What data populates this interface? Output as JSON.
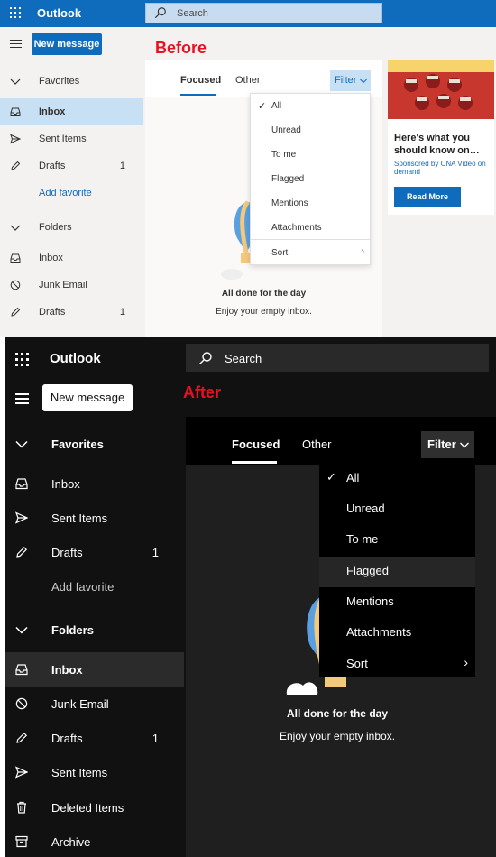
{
  "before": {
    "label": "Before",
    "app_title": "Outlook",
    "search_placeholder": "Search",
    "new_message": "New message",
    "nav": {
      "favorites_header": "Favorites",
      "favorites": [
        {
          "label": "Inbox",
          "count": "",
          "icon": "inbox-icon"
        },
        {
          "label": "Sent Items",
          "count": "",
          "icon": "send-icon"
        },
        {
          "label": "Drafts",
          "count": "1",
          "icon": "pencil-icon"
        }
      ],
      "add_favorite": "Add favorite",
      "folders_header": "Folders",
      "folders": [
        {
          "label": "Inbox",
          "count": "",
          "icon": "inbox-icon"
        },
        {
          "label": "Junk Email",
          "count": "",
          "icon": "block-icon"
        },
        {
          "label": "Drafts",
          "count": "1",
          "icon": "pencil-icon"
        }
      ]
    },
    "tabs": [
      "Focused",
      "Other"
    ],
    "filter_label": "Filter",
    "filter_menu": [
      "All",
      "Unread",
      "To me",
      "Flagged",
      "Mentions",
      "Attachments"
    ],
    "sort_label": "Sort",
    "empty_title": "All done for the day",
    "empty_subtitle": "Enjoy your empty inbox.",
    "ad": {
      "title": "Here's what you should know on…",
      "sponsor": "Sponsored by CNA Video on demand",
      "button": "Read More"
    },
    "colors": {
      "accent": "#0f6cbd",
      "label": "#e81123"
    }
  },
  "after": {
    "label": "After",
    "app_title": "Outlook",
    "search_placeholder": "Search",
    "new_message": "New message",
    "nav": {
      "favorites_header": "Favorites",
      "favorites": [
        {
          "label": "Inbox",
          "count": "",
          "icon": "inbox-icon"
        },
        {
          "label": "Sent Items",
          "count": "",
          "icon": "send-icon"
        },
        {
          "label": "Drafts",
          "count": "1",
          "icon": "pencil-icon"
        }
      ],
      "add_favorite": "Add favorite",
      "folders_header": "Folders",
      "folders": [
        {
          "label": "Inbox",
          "count": "",
          "icon": "inbox-icon"
        },
        {
          "label": "Junk Email",
          "count": "",
          "icon": "block-icon"
        },
        {
          "label": "Drafts",
          "count": "1",
          "icon": "pencil-icon"
        },
        {
          "label": "Sent Items",
          "count": "",
          "icon": "send-icon"
        },
        {
          "label": "Deleted Items",
          "count": "",
          "icon": "trash-icon"
        },
        {
          "label": "Archive",
          "count": "",
          "icon": "archive-icon"
        }
      ]
    },
    "tabs": [
      "Focused",
      "Other"
    ],
    "filter_label": "Filter",
    "filter_menu": [
      "All",
      "Unread",
      "To me",
      "Flagged",
      "Mentions",
      "Attachments"
    ],
    "sort_label": "Sort",
    "empty_title": "All done for the day",
    "empty_subtitle": "Enjoy your empty inbox.",
    "colors": {
      "background": "#111111",
      "label": "#e81123"
    }
  }
}
